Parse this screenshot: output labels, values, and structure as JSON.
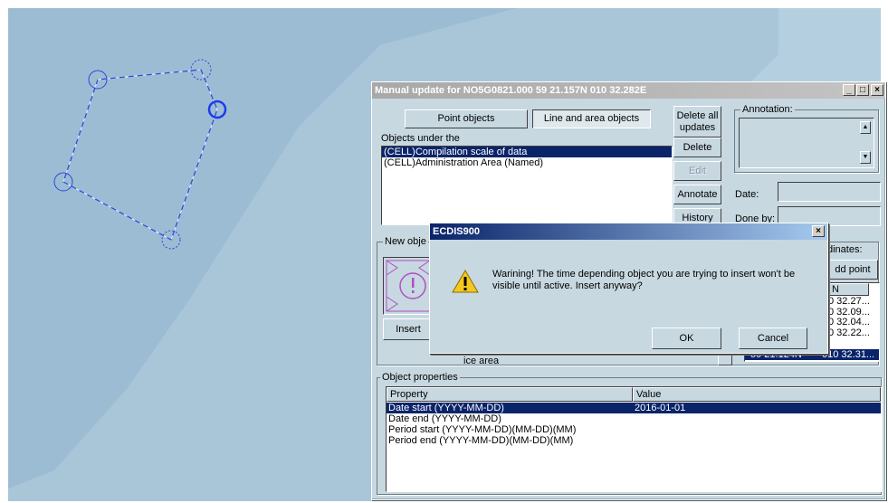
{
  "window": {
    "title": "Manual update for NO5G0821.000  59 21.157N  010 32.282E",
    "tabs": {
      "point_objects": "Point objects",
      "line_area_objects": "Line and area objects"
    },
    "objects_label": "Objects under the",
    "objects": [
      "(CELL)Compilation scale of data",
      "(CELL)Administration Area (Named)"
    ],
    "buttons": {
      "delete_all": "Delete all updates",
      "delete": "Delete",
      "edit": "Edit",
      "annotate": "Annotate",
      "history": "History",
      "add_point": "dd point",
      "insert": "Insert"
    },
    "annotation_label": "Annotation:",
    "date_label": "Date:",
    "done_by_label": "Done by:",
    "new_object_label": "New obje",
    "coordinates_label": "dinates:",
    "coord_header": "N",
    "coordinates": [
      "0 32.27...",
      "0 32.09...",
      "0 32.04...",
      "0 32.22...",
      "010 32.31..."
    ],
    "coordinates_left_last": "59 21.124N",
    "object_type_value": "ice area",
    "properties": {
      "label": "Object properties",
      "col_property": "Property",
      "col_value": "Value",
      "rows": [
        {
          "property": "Date start (YYYY-MM-DD)",
          "value": "2016-01-01"
        },
        {
          "property": "Date end (YYYY-MM-DD)",
          "value": ""
        },
        {
          "property": "Period start (YYYY-MM-DD)(MM-DD)(MM)",
          "value": ""
        },
        {
          "property": "Period end (YYYY-MM-DD)(MM-DD)(MM)",
          "value": ""
        }
      ]
    }
  },
  "dialog": {
    "title": "ECDIS900",
    "message": "Warining! The time depending object you are trying to insert won't be visible until active. Insert anyway?",
    "ok": "OK",
    "cancel": "Cancel",
    "icon": "warning-icon"
  },
  "colors": {
    "sea_deep": "#9ab8d0",
    "sea_light": "#b3d0e0",
    "polygon": "#2b48d8",
    "selection": "#0a246a",
    "window_bg": "#c7d8e0"
  }
}
